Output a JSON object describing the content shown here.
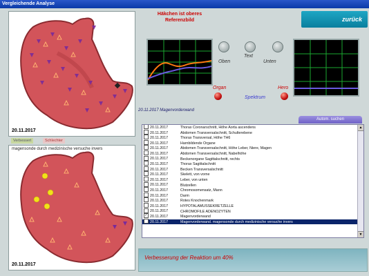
{
  "window": {
    "title": "Vergleichende Analyse"
  },
  "header": {
    "hint_line1": "Häkchen ist oberes",
    "hint_line2": "Referenzbild",
    "back_label": "zurück"
  },
  "left_panels": {
    "top_date": "20.11.2017",
    "bottom_date": "20.11.2017",
    "tab_before": "Verbessert",
    "tab_after": "Schlechter",
    "bottom_overlay_text": "magensonde durch medizinische versuche invers"
  },
  "scope": {
    "btn_top": "Oben",
    "btn_text": "Text",
    "btn_bottom": "Unten",
    "organ_label": "Organ",
    "spectrum_label": "Spektrum",
    "hero_label": "Hero"
  },
  "caption": "20.11.2017  Magenvorderwand",
  "search_label": "Autom. suchen",
  "list_items": [
    {
      "date": "20.11.2017",
      "text": "Thorax Coronarschnitt, Höhe Aorta ascendens",
      "checked": false,
      "selected": false
    },
    {
      "date": "20.11.2017",
      "text": "Abdomen Transversalschnitt, Schulterebene",
      "checked": false,
      "selected": false
    },
    {
      "date": "20.11.2017",
      "text": "Thorax Transversal, Höhe TH6",
      "checked": false,
      "selected": false
    },
    {
      "date": "20.11.2017",
      "text": "Harnbildende Organe",
      "checked": false,
      "selected": false
    },
    {
      "date": "20.11.2017",
      "text": "Abdomen Transversalschnitt, Höhe Leber, Niere, Magen",
      "checked": false,
      "selected": false
    },
    {
      "date": "20.11.2017",
      "text": "Abdomen Transversalschnitt, Nabelhöhe",
      "checked": false,
      "selected": false
    },
    {
      "date": "20.11.2017",
      "text": "Beckenorgane Sagittalschnitt, rechts",
      "checked": false,
      "selected": false
    },
    {
      "date": "20.11.2017",
      "text": "Thorax Sagittalschnitt",
      "checked": false,
      "selected": false
    },
    {
      "date": "20.11.2017",
      "text": "Becken Transversalschnitt",
      "checked": false,
      "selected": false
    },
    {
      "date": "20.11.2017",
      "text": "Skelett, von vorne",
      "checked": false,
      "selected": false
    },
    {
      "date": "20.11.2017",
      "text": "Leber, von unten",
      "checked": false,
      "selected": false
    },
    {
      "date": "20.11.2017",
      "text": "Blutzellen",
      "checked": false,
      "selected": false
    },
    {
      "date": "20.11.2017",
      "text": "Chromosomensatz, Mann",
      "checked": false,
      "selected": false
    },
    {
      "date": "20.11.2017",
      "text": "Darm",
      "checked": false,
      "selected": false
    },
    {
      "date": "20.11.2017",
      "text": "Rotes Knochenmark",
      "checked": false,
      "selected": false
    },
    {
      "date": "20.11.2017",
      "text": "HYPOTALAMUSSEKRETZELLE",
      "checked": false,
      "selected": false
    },
    {
      "date": "20.11.2017",
      "text": "CHROMOFILE ADENOZYTEN",
      "checked": false,
      "selected": false
    },
    {
      "date": "20.11.2017",
      "text": "Magenvorderwand",
      "checked": true,
      "selected": false
    },
    {
      "date": "20.11.2017",
      "text": "Magenvorderwand. magensonde durch medizinische versuche invers",
      "checked": false,
      "selected": true
    }
  ],
  "bottom_message": "Verbesserung der Reaktion um 40%",
  "colors": {
    "accent_red": "#cc0000",
    "title_blue": "#0a3aa8",
    "selection": "#0a246a"
  }
}
